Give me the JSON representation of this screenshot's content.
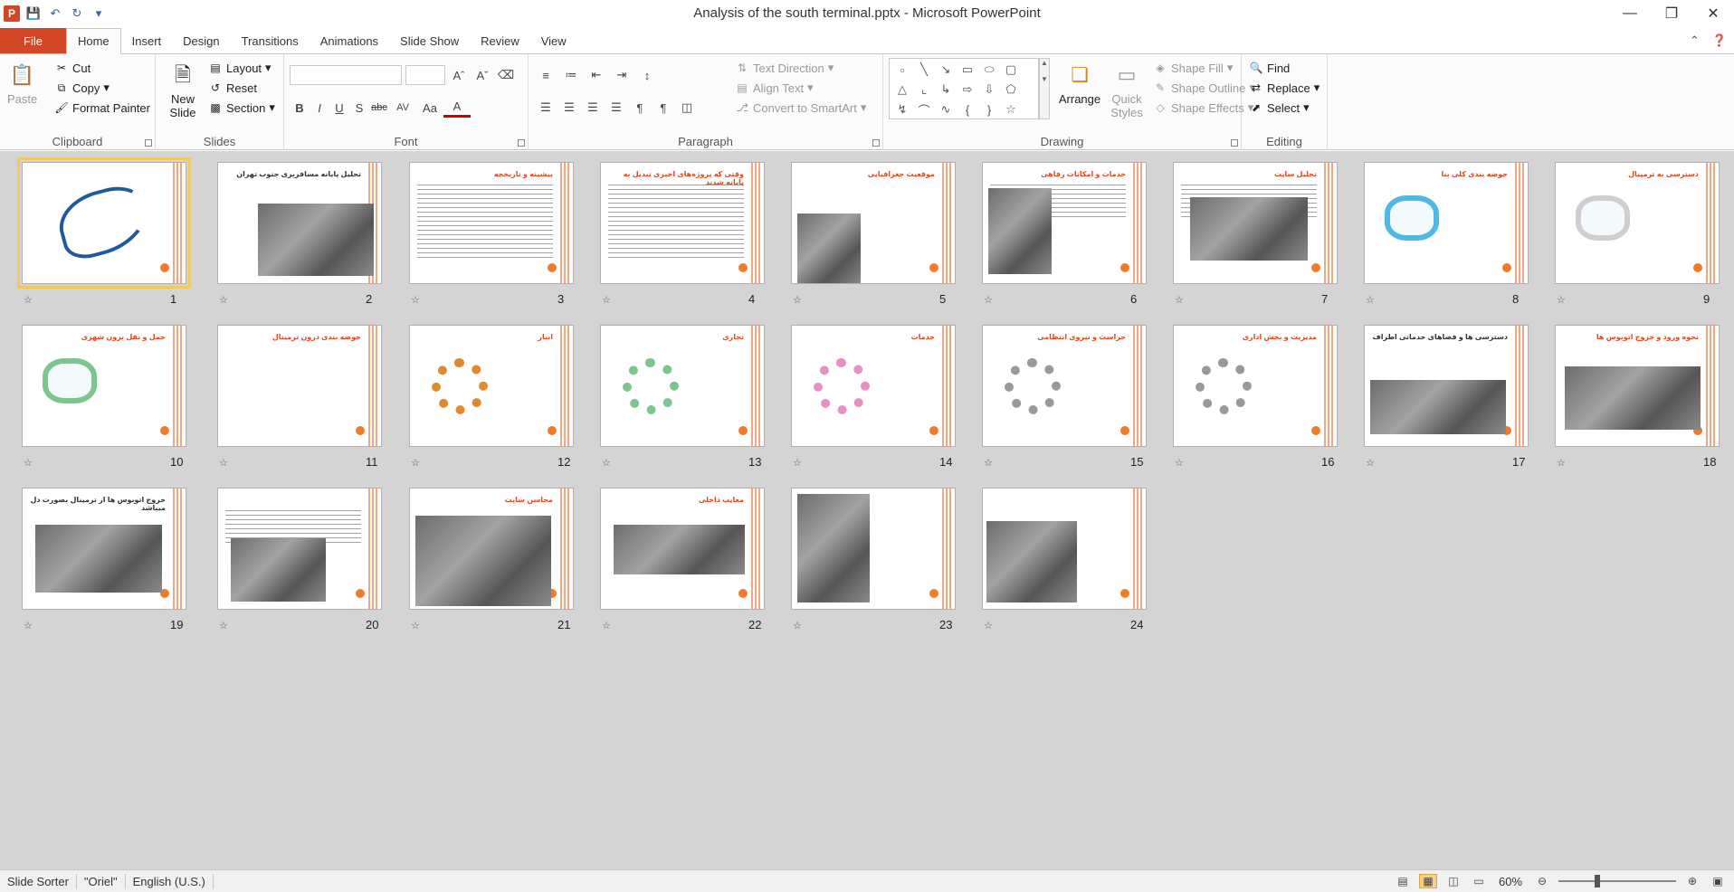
{
  "window": {
    "title": "Analysis of the south terminal.pptx  -  Microsoft PowerPoint",
    "app_icon": "P"
  },
  "tabs": [
    {
      "label": "File"
    },
    {
      "label": "Home"
    },
    {
      "label": "Insert"
    },
    {
      "label": "Design"
    },
    {
      "label": "Transitions"
    },
    {
      "label": "Animations"
    },
    {
      "label": "Slide Show"
    },
    {
      "label": "Review"
    },
    {
      "label": "View"
    }
  ],
  "ribbon": {
    "clipboard": {
      "label": "Clipboard",
      "paste": "Paste",
      "cut": "Cut",
      "copy": "Copy",
      "format_painter": "Format Painter"
    },
    "slides": {
      "label": "Slides",
      "new_slide": "New Slide",
      "layout": "Layout",
      "reset": "Reset",
      "section": "Section"
    },
    "font": {
      "label": "Font",
      "bold": "B",
      "italic": "I",
      "underline": "U",
      "shadow": "S",
      "strike": "abc",
      "spacing": "AV",
      "case": "Aa",
      "color": "A"
    },
    "paragraph": {
      "label": "Paragraph",
      "text_direction": "Text Direction",
      "align_text": "Align Text",
      "convert_smartart": "Convert to SmartArt"
    },
    "drawing": {
      "label": "Drawing",
      "arrange": "Arrange",
      "quick_styles": "Quick Styles",
      "shape_fill": "Shape Fill",
      "shape_outline": "Shape Outline",
      "shape_effects": "Shape Effects"
    },
    "editing": {
      "label": "Editing",
      "find": "Find",
      "replace": "Replace",
      "select": "Select"
    }
  },
  "slides": [
    {
      "n": "1",
      "title": ""
    },
    {
      "n": "2",
      "title": "تحلیل پایانه مسافربری جنوب تهران"
    },
    {
      "n": "3",
      "title": "پیشینه و تاریخچه"
    },
    {
      "n": "4",
      "title": "وقتی که پروژه‌های اخیری تبدیل به پایانه شدند"
    },
    {
      "n": "5",
      "title": "موقعیت جغرافیایی"
    },
    {
      "n": "6",
      "title": "خدمات و امکانات رفاهی"
    },
    {
      "n": "7",
      "title": "تحلیل سایت"
    },
    {
      "n": "8",
      "title": "حوضه بندی کلی بنا"
    },
    {
      "n": "9",
      "title": "دسترسی به ترمینال"
    },
    {
      "n": "10",
      "title": "حمل و نقل برون شهری"
    },
    {
      "n": "11",
      "title": "حوضه بندی درون ترمینال"
    },
    {
      "n": "12",
      "title": "انبار"
    },
    {
      "n": "13",
      "title": "تجاری"
    },
    {
      "n": "14",
      "title": "خدمات"
    },
    {
      "n": "15",
      "title": "حراست و نیروی انتظامی"
    },
    {
      "n": "16",
      "title": "مدیریت و بخش اداری"
    },
    {
      "n": "17",
      "title": "دسترسی ها و فضاهای خدماتی اطراف"
    },
    {
      "n": "18",
      "title": "نحوه ورود و خروج اتوبوس ها"
    },
    {
      "n": "19",
      "title": "خروج اتوبوس ها از ترمینال بصورت دل میباشد"
    },
    {
      "n": "20",
      "title": ""
    },
    {
      "n": "21",
      "title": "محاسن سایت"
    },
    {
      "n": "22",
      "title": "معایب داخلی"
    },
    {
      "n": "23",
      "title": ""
    },
    {
      "n": "24",
      "title": ""
    }
  ],
  "status": {
    "view": "Slide Sorter",
    "theme": "\"Oriel\"",
    "language": "English (U.S.)",
    "zoom": "60%"
  },
  "colors": {
    "file_tab": "#d24726",
    "accent_orange": "#f07b2a",
    "selection": "#f1c95f"
  }
}
